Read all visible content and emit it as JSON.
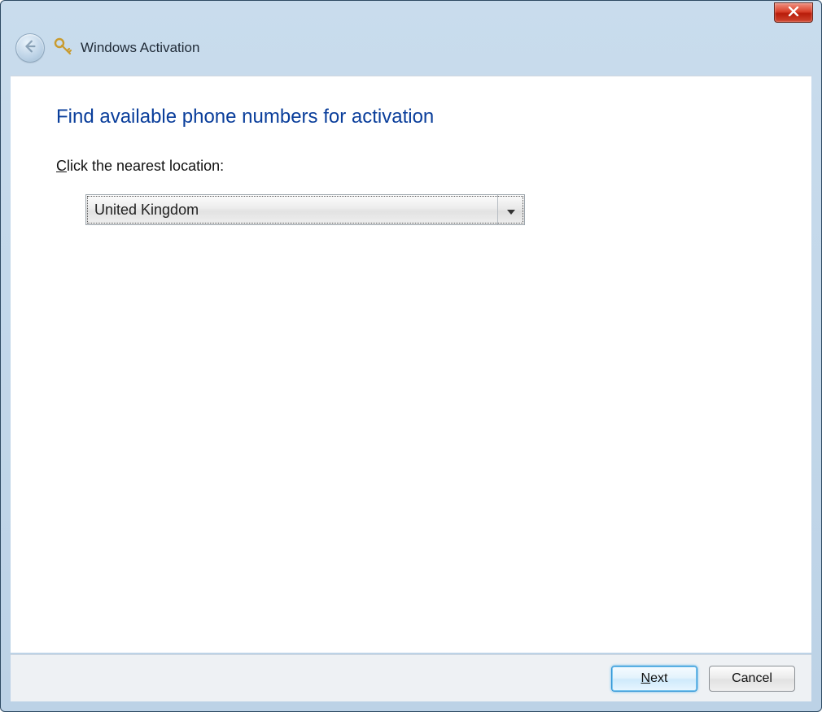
{
  "window": {
    "app_title": "Windows Activation"
  },
  "page": {
    "heading": "Find available phone numbers for activation",
    "prompt_prefix_underlined": "C",
    "prompt_rest": "lick the nearest location:"
  },
  "combo": {
    "selected": "United Kingdom"
  },
  "buttons": {
    "next_underlined": "N",
    "next_rest": "ext",
    "cancel": "Cancel"
  }
}
